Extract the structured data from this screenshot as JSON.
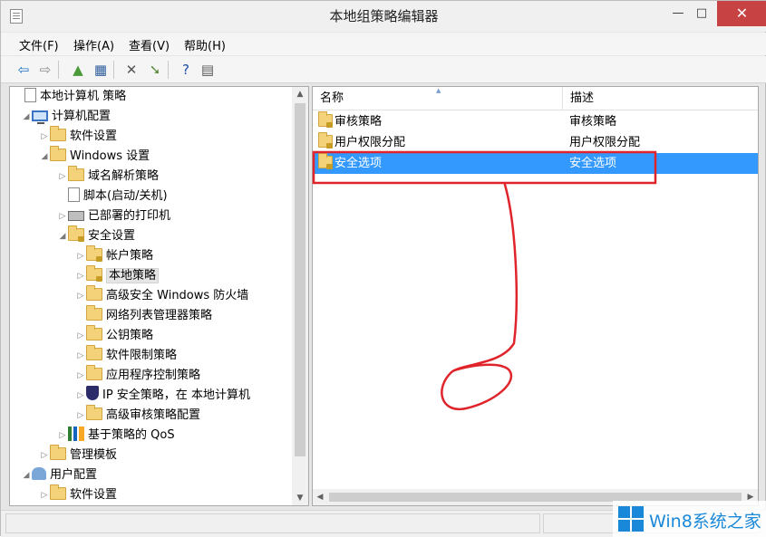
{
  "window": {
    "title": "本地组策略编辑器"
  },
  "window_controls": {
    "minimize": "—",
    "maximize": "□",
    "close": "✕"
  },
  "menu": [
    "文件(F)",
    "操作(A)",
    "查看(V)",
    "帮助(H)"
  ],
  "toolbar": [
    {
      "name": "back-icon",
      "glyph": "⇦",
      "color": "#1e73c8"
    },
    {
      "name": "forward-icon",
      "glyph": "⇨",
      "color": "#8a8a8a"
    },
    {
      "name": "up-folder-icon",
      "glyph": "▲",
      "color": "#4a9a3a"
    },
    {
      "name": "show-hide-tree-icon",
      "glyph": "▦",
      "color": "#2f5e9e"
    },
    {
      "name": "delete-icon",
      "glyph": "✕",
      "color": "#555555"
    },
    {
      "name": "export-list-icon",
      "glyph": "➘",
      "color": "#5a8a3a"
    },
    {
      "name": "help-icon",
      "glyph": "?",
      "color": "#1f4fa8"
    },
    {
      "name": "properties-icon",
      "glyph": "▤",
      "color": "#555555"
    }
  ],
  "tree": [
    {
      "label": "本地计算机 策略",
      "icon": "doc",
      "exp": "",
      "level": 0
    },
    {
      "label": "计算机配置",
      "icon": "computer",
      "exp": "◢",
      "level": 1
    },
    {
      "label": "软件设置",
      "icon": "folder",
      "exp": "▷",
      "level": 2
    },
    {
      "label": "Windows 设置",
      "icon": "folder",
      "exp": "◢",
      "level": 2
    },
    {
      "label": "域名解析策略",
      "icon": "folder",
      "exp": "▷",
      "level": 3
    },
    {
      "label": "脚本(启动/关机)",
      "icon": "doc",
      "exp": "",
      "level": 3
    },
    {
      "label": "已部署的打印机",
      "icon": "printer",
      "exp": "▷",
      "level": 3
    },
    {
      "label": "安全设置",
      "icon": "lockfolder",
      "exp": "◢",
      "level": 3
    },
    {
      "label": "帐户策略",
      "icon": "lockfolder",
      "exp": "▷",
      "level": 4
    },
    {
      "label": "本地策略",
      "icon": "lockfolder",
      "exp": "▷",
      "level": 4,
      "selected": true
    },
    {
      "label": "高级安全 Windows 防火墙",
      "icon": "folder",
      "exp": "▷",
      "level": 4
    },
    {
      "label": "网络列表管理器策略",
      "icon": "folder",
      "exp": "",
      "level": 4
    },
    {
      "label": "公钥策略",
      "icon": "folder",
      "exp": "▷",
      "level": 4
    },
    {
      "label": "软件限制策略",
      "icon": "folder",
      "exp": "▷",
      "level": 4
    },
    {
      "label": "应用程序控制策略",
      "icon": "folder",
      "exp": "▷",
      "level": 4
    },
    {
      "label": "IP 安全策略，在 本地计算机",
      "icon": "shield",
      "exp": "▷",
      "level": 4
    },
    {
      "label": "高级审核策略配置",
      "icon": "folder",
      "exp": "▷",
      "level": 4
    },
    {
      "label": "基于策略的 QoS",
      "icon": "bars",
      "exp": "▷",
      "level": 3
    },
    {
      "label": "管理模板",
      "icon": "folder",
      "exp": "▷",
      "level": 2
    },
    {
      "label": "用户配置",
      "icon": "users",
      "exp": "◢",
      "level": 1
    },
    {
      "label": "软件设置",
      "icon": "folder",
      "exp": "▷",
      "level": 2
    }
  ],
  "list": {
    "columns": [
      "名称",
      "描述"
    ],
    "rows": [
      {
        "name": "审核策略",
        "desc": "审核策略",
        "selected": false
      },
      {
        "name": "用户权限分配",
        "desc": "用户权限分配",
        "selected": false
      },
      {
        "name": "安全选项",
        "desc": "安全选项",
        "selected": true
      }
    ]
  },
  "scroll_glyphs": {
    "up": "▲",
    "down": "▼",
    "left": "◀",
    "right": "▶"
  },
  "watermark": {
    "text": "Win8系统之家"
  },
  "colors": {
    "selection": "#3399ff",
    "annotation": "#e0242b",
    "close_button": "#c74343",
    "watermark": "#1a88d8"
  }
}
